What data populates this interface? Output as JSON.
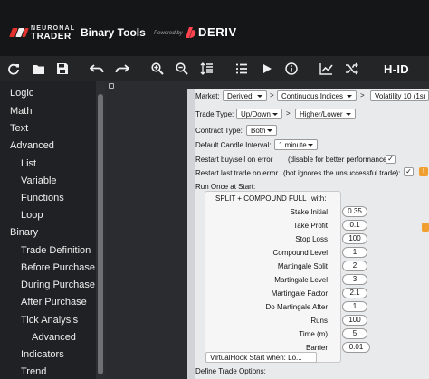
{
  "brand": {
    "line1": "NEURONAL",
    "line2": "TRADER"
  },
  "app_title": "Binary Tools",
  "powered_by": "Powered by",
  "deriv_logo": "DERIV",
  "toolbar": {
    "icons": [
      "reset-icon",
      "folder-open-icon",
      "save-icon",
      "undo-icon",
      "redo-icon",
      "zoom-in-icon",
      "zoom-out-icon",
      "sort-icon",
      "list-icon",
      "play-icon",
      "info-icon",
      "chart-icon",
      "shuffle-icon"
    ],
    "hid_label": "H-ID"
  },
  "sidebar": {
    "categories": [
      {
        "label": "Logic",
        "level": 0
      },
      {
        "label": "Math",
        "level": 0
      },
      {
        "label": "Text",
        "level": 0
      },
      {
        "label": "Advanced",
        "level": 0
      },
      {
        "label": "List",
        "level": 1
      },
      {
        "label": "Variable",
        "level": 1
      },
      {
        "label": "Functions",
        "level": 1
      },
      {
        "label": "Loop",
        "level": 1
      },
      {
        "label": "Binary",
        "level": 0
      },
      {
        "label": "Trade Definition",
        "level": 1
      },
      {
        "label": "Before Purchase",
        "level": 1
      },
      {
        "label": "During Purchase",
        "level": 1
      },
      {
        "label": "After Purchase",
        "level": 1
      },
      {
        "label": "Tick Analysis",
        "level": 1
      },
      {
        "label": "Advanced",
        "level": 2
      },
      {
        "label": "Indicators",
        "level": 1
      },
      {
        "label": "Trend",
        "level": 1
      }
    ]
  },
  "block": {
    "market_label": "Market:",
    "market_options": [
      "Derived",
      "Continuous Indices",
      "Volatility 10 (1s) In"
    ],
    "trade_type_label": "Trade Type:",
    "trade_type_options": [
      "Up/Down",
      "Higher/Lower"
    ],
    "contract_type_label": "Contract Type:",
    "contract_type_value": "Both",
    "candle_interval_label": "Default Candle Interval:",
    "candle_interval_value": "1 minute",
    "restart_error_label": "Restart buy/sell on error",
    "restart_error_note": "(disable for better performance):",
    "restart_error_checked": "✓",
    "restart_last_label": "Restart last trade on error",
    "restart_last_note": "(bot ignores the unsuccessful trade):",
    "restart_last_checked": "✓",
    "warning_glyph": "!",
    "run_once_label": "Run Once at Start:",
    "define_trade_label": "Define Trade Options:"
  },
  "strategy": {
    "title": "SPLIT + COMPOUND FULL",
    "with_label": "with:",
    "params": [
      {
        "label": "Stake Initial",
        "value": "0.35"
      },
      {
        "label": "Take Profit",
        "value": "0.1"
      },
      {
        "label": "Stop Loss",
        "value": "100"
      },
      {
        "label": "Compound Level",
        "value": "1"
      },
      {
        "label": "Martingale Split",
        "value": "2"
      },
      {
        "label": "Martingale Level",
        "value": "3"
      },
      {
        "label": "Martingale Factor",
        "value": "2.1"
      },
      {
        "label": "Do Martingale After",
        "value": "1"
      },
      {
        "label": "Runs",
        "value": "100"
      },
      {
        "label": "Time (m)",
        "value": "5"
      },
      {
        "label": "Barrier",
        "value": "0.01"
      }
    ],
    "virtualhook_label": "VirtualHook Start when:",
    "virtualhook_value": "Lo..."
  }
}
